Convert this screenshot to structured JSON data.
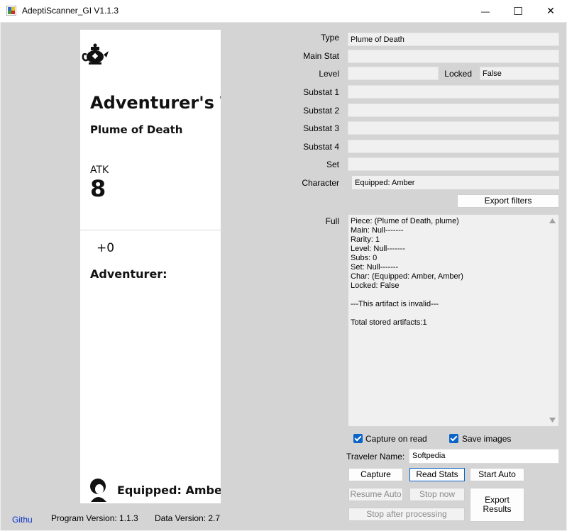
{
  "window": {
    "title": "AdeptiScanner_GI V1.1.3",
    "minimize": "—",
    "maximize": "☐",
    "close": "✕"
  },
  "preview": {
    "card_title": "Adventurer's T",
    "piece_name": "Plume of Death",
    "stat_name": "ATK",
    "stat_value": "8",
    "level": "+0",
    "set_name": "Adventurer:",
    "equipped": "Equipped: Amber",
    "icon": "teapot-icon",
    "char_icon": "character-portrait-icon"
  },
  "form": {
    "type_label": "Type",
    "type_value": "Plume of Death",
    "main_stat_label": "Main Stat",
    "main_stat_value": "",
    "level_label": "Level",
    "level_value": "",
    "locked_label": "Locked",
    "locked_value": "False",
    "substat1_label": "Substat 1",
    "substat1_value": "",
    "substat2_label": "Substat 2",
    "substat2_value": "",
    "substat3_label": "Substat 3",
    "substat3_value": "",
    "substat4_label": "Substat 4",
    "substat4_value": "",
    "set_label": "Set",
    "set_value": "",
    "character_label": "Character",
    "character_value": "Equipped: Amber",
    "export_filters": "Export filters",
    "full_label": "Full",
    "full_text": "Piece: (Plume of Death, plume)\nMain: Null-------\nRarity: 1\nLevel: Null-------\nSubs: 0\nSet: Null-------\nChar: (Equipped: Amber, Amber)\nLocked: False\n\n---This artifact is invalid---\n\nTotal stored artifacts:1"
  },
  "options": {
    "capture_on_read": "Capture on read",
    "save_images": "Save images",
    "traveler_name_label": "Traveler Name:",
    "traveler_name_value": "Softpedia"
  },
  "buttons": {
    "capture": "Capture",
    "read_stats": "Read Stats",
    "start_auto": "Start Auto",
    "resume_auto": "Resume Auto",
    "stop_now": "Stop now",
    "export_results": "Export Results",
    "stop_after_processing": "Stop after processing"
  },
  "status": {
    "github": "Githu",
    "program_version": "Program Version: 1.1.3",
    "data_version": "Data Version: 2.7"
  },
  "colors": {
    "accent": "#0a64c8",
    "background": "#d4d4d4",
    "titlebar": "#ffffff"
  }
}
